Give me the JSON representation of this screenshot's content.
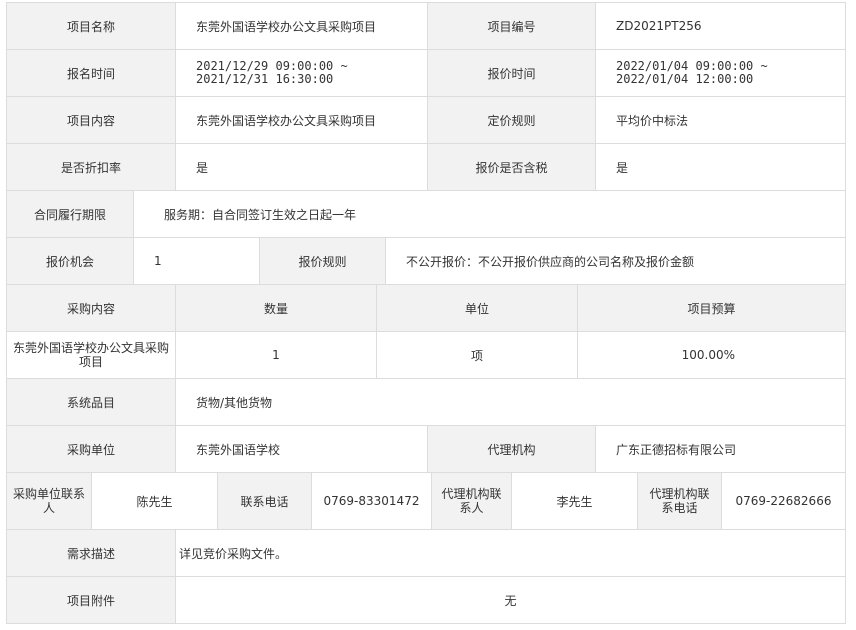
{
  "project": {
    "name_label": "项目名称",
    "name": "东莞外国语学校办公文具采购项目",
    "code_label": "项目编号",
    "code": "ZD2021PT256",
    "signup_label": "报名时间",
    "signup_time": "2021/12/29 09:00:00 ~\n2021/12/31 16:30:00",
    "quote_time_label": "报价时间",
    "quote_time": "2022/01/04 09:00:00 ~\n2022/01/04 12:00:00",
    "content_label": "项目内容",
    "content": "东莞外国语学校办公文具采购项目",
    "pricing_rule_label": "定价规则",
    "pricing_rule": "平均价中标法",
    "discount_label": "是否折扣率",
    "discount": "是",
    "tax_label": "报价是否含税",
    "tax": "是",
    "contract_period_label": "合同履行期限",
    "contract_period": "服务期：自合同签订生效之日起一年",
    "quote_chances_label": "报价机会",
    "quote_chances": "1",
    "quote_rule_label": "报价规则",
    "quote_rule": "不公开报价：不公开报价供应商的公司名称及报价金额"
  },
  "procurement_table": {
    "headers": [
      "采购内容",
      "数量",
      "单位",
      "项目预算"
    ],
    "rows": [
      [
        "东莞外国语学校办公文具采购项目",
        "1",
        "项",
        "100.00%"
      ]
    ]
  },
  "details": {
    "category_label": "系统品目",
    "category": "货物/其他货物",
    "buyer_label": "采购单位",
    "buyer": "东莞外国语学校",
    "agency_label": "代理机构",
    "agency": "广东正德招标有限公司",
    "buyer_contact_label": "采购单位联系人",
    "buyer_contact": "陈先生",
    "buyer_phone_label": "联系电话",
    "buyer_phone": "0769-83301472",
    "agency_contact_label": "代理机构联系人",
    "agency_contact": "李先生",
    "agency_phone_label": "代理机构联系电话",
    "agency_phone": "0769-22682666",
    "requirement_label": "需求描述",
    "requirement": "详见竞价采购文件。",
    "attachment_label": "项目附件",
    "attachment": "无"
  }
}
